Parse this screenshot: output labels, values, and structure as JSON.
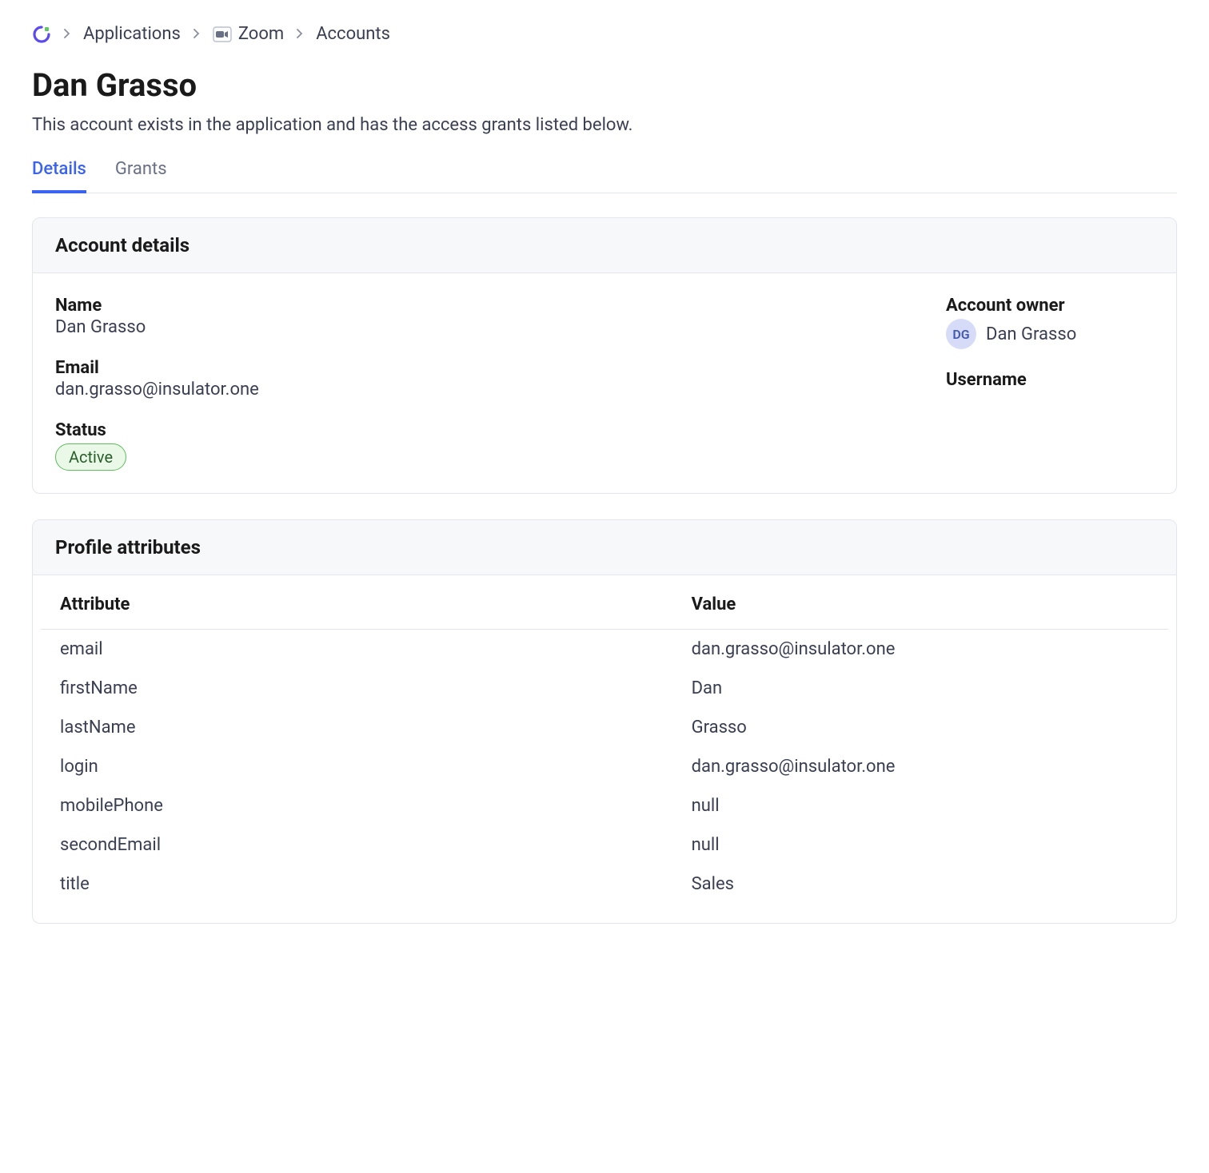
{
  "breadcrumb": {
    "applications": "Applications",
    "app_name": "Zoom",
    "accounts": "Accounts"
  },
  "header": {
    "title": "Dan Grasso",
    "subtitle": "This account exists in the application and has the access grants listed below."
  },
  "tabs": {
    "details": "Details",
    "grants": "Grants"
  },
  "account_details": {
    "card_title": "Account details",
    "name_label": "Name",
    "name": "Dan Grasso",
    "email_label": "Email",
    "email": "dan.grasso@insulator.one",
    "status_label": "Status",
    "status": "Active",
    "owner_label": "Account owner",
    "owner_initials": "DG",
    "owner_name": "Dan Grasso",
    "username_label": "Username",
    "username": ""
  },
  "profile": {
    "card_title": "Profile attributes",
    "col_attribute": "Attribute",
    "col_value": "Value",
    "rows": [
      {
        "attr": "email",
        "value": "dan.grasso@insulator.one"
      },
      {
        "attr": "firstName",
        "value": "Dan"
      },
      {
        "attr": "lastName",
        "value": "Grasso"
      },
      {
        "attr": "login",
        "value": "dan.grasso@insulator.one"
      },
      {
        "attr": "mobilePhone",
        "value": "null"
      },
      {
        "attr": "secondEmail",
        "value": "null"
      },
      {
        "attr": "title",
        "value": "Sales"
      }
    ]
  }
}
